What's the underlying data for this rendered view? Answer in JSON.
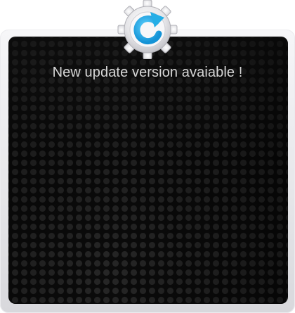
{
  "dialog": {
    "message": "New update version avaiable !",
    "icon": "update-refresh-icon",
    "colors": {
      "icon_accent": "#2bb4e8",
      "gear": "#e3e3e6",
      "panel": "#0b0b0b",
      "text": "#d6d6d6"
    }
  }
}
